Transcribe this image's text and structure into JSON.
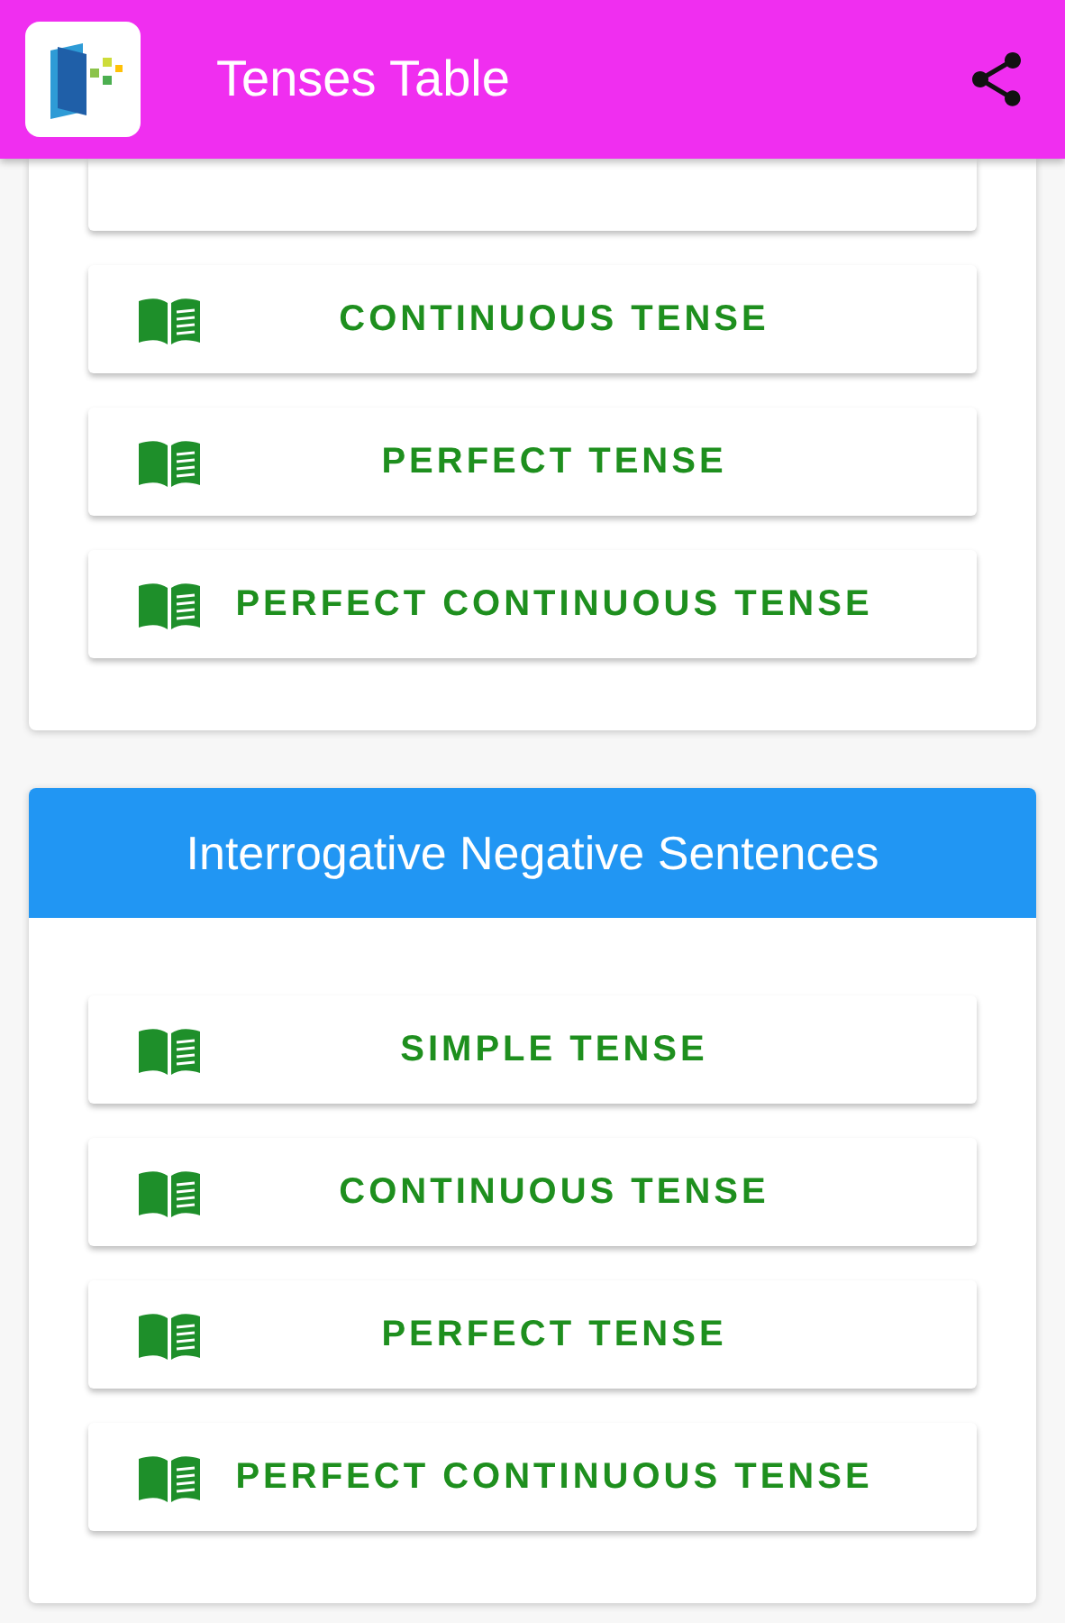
{
  "app_bar": {
    "title": "Tenses Table"
  },
  "sections": [
    {
      "buttons": [
        {
          "kind": "stub"
        },
        {
          "kind": "full",
          "label": "CONTINUOUS TENSE"
        },
        {
          "kind": "full",
          "label": "PERFECT TENSE"
        },
        {
          "kind": "full",
          "label": "PERFECT CONTINUOUS TENSE"
        }
      ]
    },
    {
      "title": "Interrogative Negative Sentences",
      "buttons": [
        {
          "kind": "full",
          "label": "SIMPLE TENSE"
        },
        {
          "kind": "full",
          "label": "CONTINUOUS TENSE"
        },
        {
          "kind": "full",
          "label": "PERFECT TENSE"
        },
        {
          "kind": "full",
          "label": "PERFECT CONTINUOUS TENSE"
        }
      ]
    }
  ]
}
